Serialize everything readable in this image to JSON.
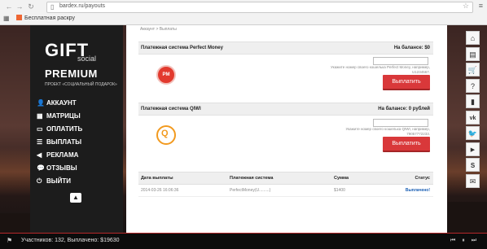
{
  "browser": {
    "back_icon": "arrow-left",
    "forward_icon": "arrow-right",
    "reload_icon": "reload",
    "url": "bardex.ru/payouts",
    "bookmark": "Бесплатная раскру"
  },
  "logo": {
    "gift": "GIFT",
    "social": "social",
    "premium": "PREMIUM",
    "project": "ПРОЕКТ «СОЦИАЛЬНЫЙ ПОДАРОК»"
  },
  "nav": [
    {
      "label": "АККАУНТ",
      "icon": "user"
    },
    {
      "label": "МАТРИЦЫ",
      "icon": "grid"
    },
    {
      "label": "ОПЛАТИТЬ",
      "icon": "card"
    },
    {
      "label": "ВЫПЛАТЫ",
      "icon": "list"
    },
    {
      "label": "РЕКЛАМА",
      "icon": "megaphone"
    },
    {
      "label": "ОТЗЫВЫ",
      "icon": "chat"
    },
    {
      "label": "ВЫЙТИ",
      "icon": "power"
    }
  ],
  "breadcrumb": "Аккаунт > Выплаты",
  "perfect_money": {
    "title": "Платежная система Perfect Money",
    "balance": "На балансе: $0",
    "logo_text": "PM",
    "hint": "Укажите номер своего кошелька Perfect Money, например, U1234567.",
    "button": "Выплатить"
  },
  "qiwi": {
    "title": "Платежная система QIWI",
    "balance": "На балансе: 0 рублей",
    "logo_text": "Q",
    "hint": "Укажите номер своего кошелька QIWI, например, 79057772233.",
    "button": "Выплатить"
  },
  "payouts_table": {
    "headers": [
      "Дата выплаты",
      "Платежная система",
      "Сумма",
      "Статус"
    ],
    "rows": [
      {
        "date": "2014-03-26 16:06:36",
        "system": "PerfectMoney(U.........)",
        "amount": "$1400",
        "status": "Выплачено!"
      }
    ]
  },
  "social_rail": [
    "home-icon",
    "document-icon",
    "cart-icon",
    "help-icon",
    "chart-icon",
    "vk-icon",
    "twitter-icon",
    "youtube-icon",
    "skype-icon",
    "mail-icon"
  ],
  "footer": {
    "stats": "Участников: 132, Выплачено: $19630",
    "player": "⏮ ⏸ ⏭"
  },
  "colors": {
    "accent_red": "#d9383a",
    "sidebar_bg": "#1c1c1c",
    "paid_blue": "#1a5fb4"
  }
}
